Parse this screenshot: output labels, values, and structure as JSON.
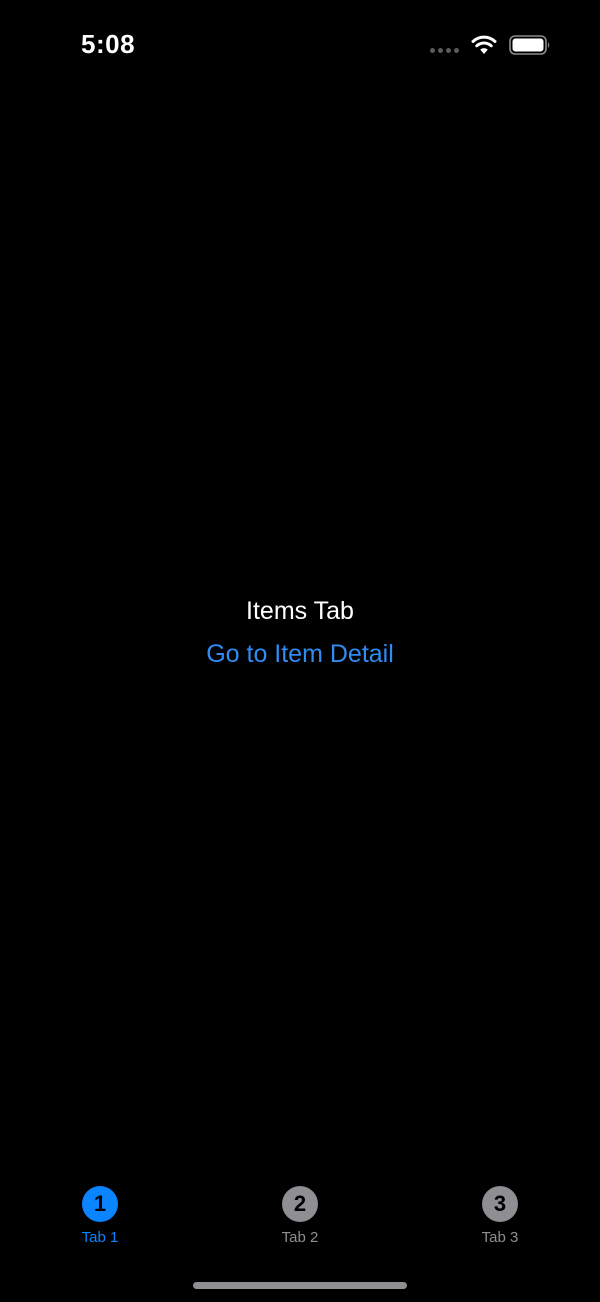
{
  "status_bar": {
    "time": "5:08",
    "icons": [
      "cellular-signal-icon",
      "wifi-icon",
      "battery-icon"
    ]
  },
  "content": {
    "title": "Items Tab",
    "link_label": "Go to Item Detail"
  },
  "tab_bar": {
    "selected_index": 0,
    "tabs": [
      {
        "badge": "1",
        "label": "Tab 1",
        "selected": true
      },
      {
        "badge": "2",
        "label": "Tab 2",
        "selected": false
      },
      {
        "badge": "3",
        "label": "Tab 3",
        "selected": false
      }
    ]
  },
  "colors": {
    "background": "#000000",
    "accent": "#0a84ff",
    "link": "#2f8cf2",
    "inactive_tab": "#8e8e93",
    "text": "#ffffff"
  }
}
